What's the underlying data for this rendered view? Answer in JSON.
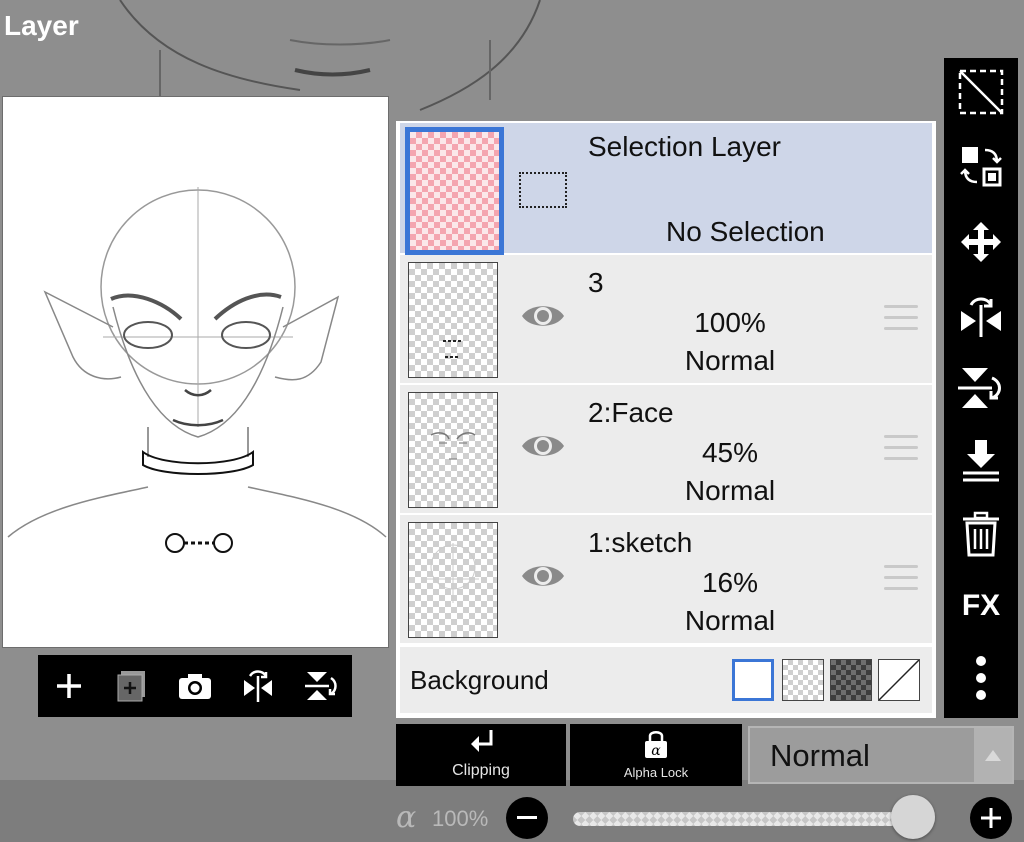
{
  "app": {
    "title": "Layer"
  },
  "preview_toolbar": {
    "buttons": [
      "add-layer",
      "add-copy-layer",
      "camera",
      "flip-horizontal",
      "flip-vertical"
    ]
  },
  "layers": {
    "selection": {
      "name": "Selection Layer",
      "status": "No Selection"
    },
    "items": [
      {
        "name": "3",
        "opacity": "100%",
        "blend": "Normal",
        "visible": true
      },
      {
        "name": "2:Face",
        "opacity": "45%",
        "blend": "Normal",
        "visible": true
      },
      {
        "name": "1:sketch",
        "opacity": "16%",
        "blend": "Normal",
        "visible": true
      }
    ],
    "background": {
      "label": "Background",
      "selected": "white"
    }
  },
  "right_toolbar": {
    "fx_label": "FX",
    "icons": [
      "select-layer-icon",
      "transform-icon",
      "move-icon",
      "flip-horizontal-icon",
      "flip-vertical-icon",
      "merge-down-icon",
      "trash-icon",
      "fx-icon",
      "more-icon"
    ]
  },
  "bottom": {
    "clipping_label": "Clipping",
    "alpha_lock_label": "Alpha Lock",
    "blend_mode": "Normal",
    "opacity_symbol": "α",
    "opacity_value": "100%",
    "opacity_fraction": 1.0
  },
  "colors": {
    "accent": "#3b76d6",
    "selection_row": "#ced6e8",
    "layer_row": "#ececec"
  }
}
